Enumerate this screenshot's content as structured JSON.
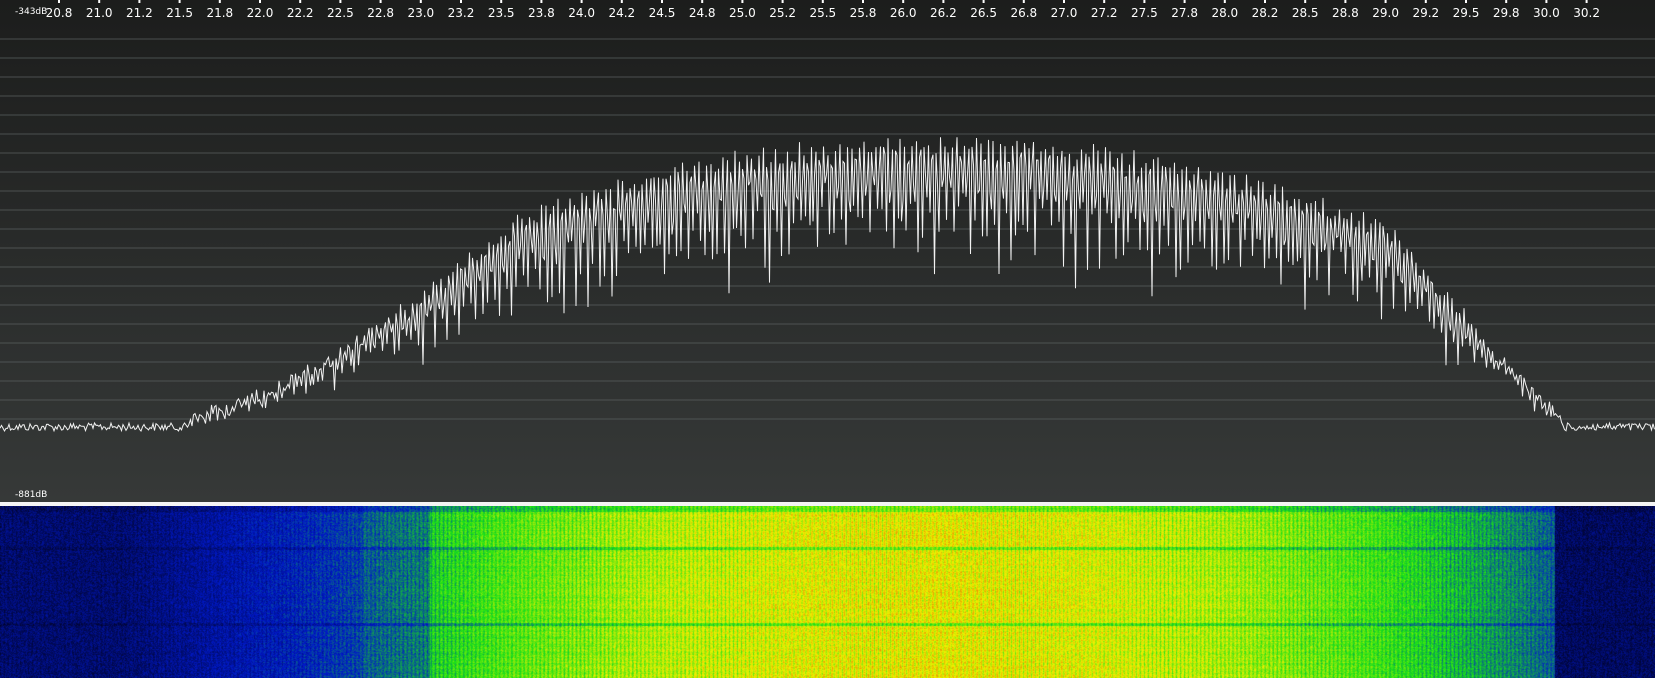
{
  "spectrum": {
    "top_db_label": "-343dB",
    "bottom_db_label": "-881dB",
    "frequency_ticks": [
      "20.8",
      "21.0",
      "21.2",
      "21.5",
      "21.8",
      "22.0",
      "22.2",
      "22.5",
      "22.8",
      "23.0",
      "23.2",
      "23.5",
      "23.8",
      "24.0",
      "24.2",
      "24.5",
      "24.8",
      "25.0",
      "25.2",
      "25.5",
      "25.8",
      "26.0",
      "26.2",
      "26.5",
      "26.8",
      "27.0",
      "27.2",
      "27.5",
      "27.8",
      "28.0",
      "28.2",
      "28.5",
      "28.8",
      "29.0",
      "29.2",
      "29.5",
      "29.8",
      "30.0",
      "30.2"
    ],
    "trace_color": "#f2f2f2",
    "background_top": "#1c1d1c",
    "background_bottom": "#363938"
  },
  "waterfall": {
    "palette": [
      "#000018",
      "#0018c8",
      "#18e018",
      "#f0f000",
      "#e05000"
    ]
  }
}
